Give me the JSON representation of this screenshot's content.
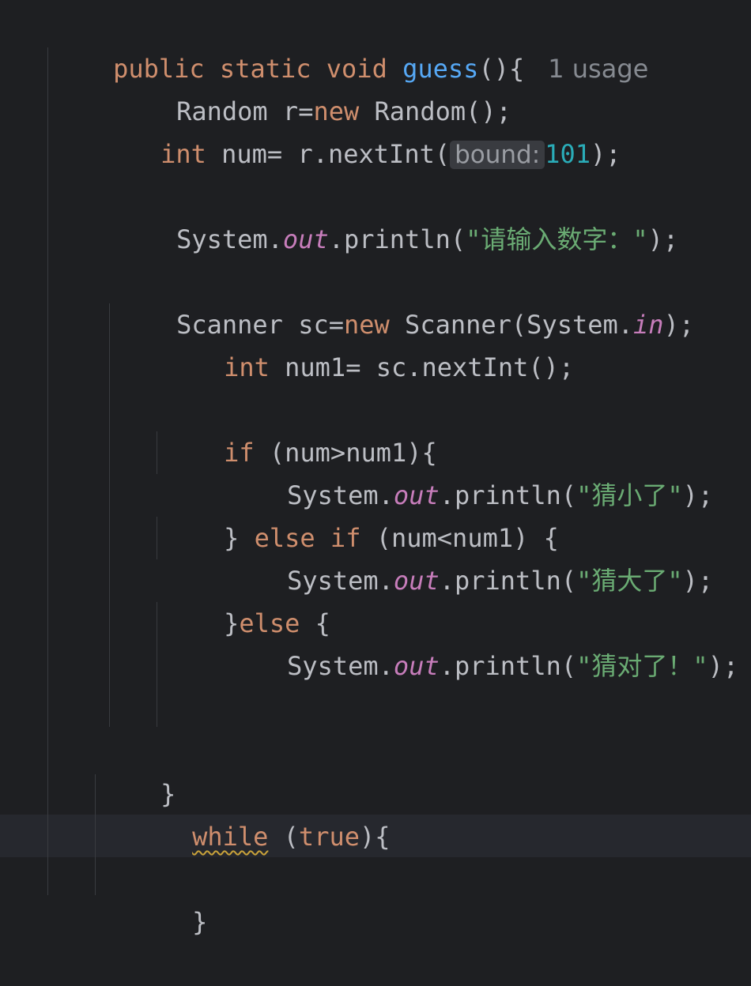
{
  "editor": {
    "lines": {
      "l1": {
        "kw": "public static void ",
        "fn": "guess",
        "rest": "(){",
        "hint": "1 usage"
      },
      "l2": {
        "a": "Random r=",
        "kw": "new",
        "b": " Random();"
      },
      "l3": {
        "kw": "int",
        "a": " num= r.nextInt(",
        "hint": "bound:",
        "num": "101",
        "b": ");"
      },
      "l4": {
        "a": "System.",
        "field": "out",
        "b": ".println(",
        "str": "\"请输入数字：\"",
        "c": ");"
      },
      "l5": {
        "a": "Scanner sc=",
        "kw": "new",
        "b": " Scanner(System.",
        "field": "in",
        "c": ");"
      },
      "l6": {
        "kw": "int",
        "a": " num1= sc.nextInt();"
      },
      "l7": {
        "kw": "if",
        "a": " (num>num1){"
      },
      "l8": {
        "a": "System.",
        "field": "out",
        "b": ".println(",
        "str": "\"猜小了\"",
        "c": ");"
      },
      "l9": {
        "a": "} ",
        "kw1": "else",
        "sp": " ",
        "kw2": "if",
        "b": " (num<num1) {"
      },
      "l10": {
        "a": "System.",
        "field": "out",
        "b": ".println(",
        "str": "\"猜大了\"",
        "c": ");"
      },
      "l11": {
        "a": "}",
        "kw": "else",
        "b": " {"
      },
      "l12": {
        "a": "System.",
        "field": "out",
        "b": ".println(",
        "str": "\"猜对了！\"",
        "c": ");"
      },
      "l13": {
        "a": "}"
      },
      "l14": {
        "kw": "while",
        "a": " (",
        "kw2": "true",
        "b": "){"
      },
      "l15": {
        "a": "}"
      }
    }
  },
  "colors": {
    "background": "#1e1f22",
    "keyword": "#cf8e6d",
    "method": "#56a8f5",
    "string": "#6aab73",
    "number": "#2aacb8",
    "field": "#c77dbb",
    "text": "#bcbec4"
  }
}
